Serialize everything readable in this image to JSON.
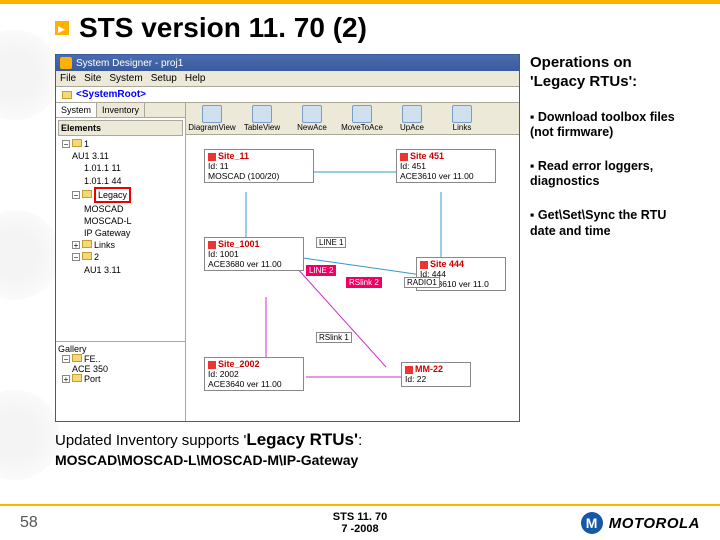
{
  "slide": {
    "title": "STS version 11. 70 (2)",
    "page_number": "58",
    "footer_line1": "STS 11. 70",
    "footer_line2": "7 -2008",
    "brand": "MOTOROLA"
  },
  "right": {
    "heading": "Operations on 'Legacy RTUs':",
    "b1": "Download toolbox files (not firmware)",
    "b2": "Read error loggers, diagnostics",
    "b3": "Get\\Set\\Sync the RTU date and time"
  },
  "captions": {
    "line1_a": "Updated Inventory supports '",
    "line1_b": "Legacy RTUs'",
    "line1_c": ":",
    "line2": "MOSCAD\\MOSCAD-L\\MOSCAD-M\\IP-Gateway"
  },
  "app": {
    "window_title": "System Designer - proj1",
    "menus": [
      "File",
      "Site",
      "System",
      "Setup",
      "Help"
    ],
    "sysroot": "<SystemRoot>",
    "side_tabs": {
      "active": "System",
      "inactive": "Inventory"
    },
    "elements_hdr": "Elements",
    "gallery_hdr": "Gallery",
    "tree": [
      {
        "l": 0,
        "box": "−",
        "fld": true,
        "label": "1"
      },
      {
        "l": 1,
        "box": "",
        "fld": false,
        "label": "AU1 3.11"
      },
      {
        "l": 2,
        "box": "",
        "fld": false,
        "label": "1.01.1 11"
      },
      {
        "l": 2,
        "box": "",
        "fld": false,
        "label": "1.01.1 44"
      },
      {
        "l": 1,
        "box": "−",
        "fld": true,
        "label": "Legacy",
        "legacy": true
      },
      {
        "l": 2,
        "box": "",
        "fld": false,
        "label": "MOSCAD"
      },
      {
        "l": 2,
        "box": "",
        "fld": false,
        "label": "MOSCAD-L"
      },
      {
        "l": 2,
        "box": "",
        "fld": false,
        "label": "IP Gateway"
      },
      {
        "l": 1,
        "box": "+",
        "fld": true,
        "label": "Links"
      },
      {
        "l": 1,
        "box": "−",
        "fld": true,
        "label": "2"
      },
      {
        "l": 2,
        "box": "",
        "fld": false,
        "label": "AU1 3.11"
      }
    ],
    "gallery_items": [
      "FE..",
      "ACE 350",
      "Port"
    ],
    "toolbar": [
      "DiagramView",
      "TableView",
      "NewAce",
      "MoveToAce",
      "UpAce",
      "Links"
    ],
    "nodes": {
      "site11": {
        "title": "Site_11",
        "l1": "Id: 11",
        "l2": "MOSCAD (100/20)"
      },
      "site451": {
        "title": "Site 451",
        "l1": "Id: 451",
        "l2": "ACE3610 ver 11.00"
      },
      "site1001": {
        "title": "Site_1001",
        "l1": "Id: 1001",
        "l2": "ACE3680 ver 11.00"
      },
      "site444": {
        "title": "Site 444",
        "l1": "Id: 444",
        "l2": "ACE3610 ver 11.0"
      },
      "site2002": {
        "title": "Site_2002",
        "l1": "Id: 2002",
        "l2": "ACE3640 ver 11.00"
      },
      "mm22": {
        "title": "MM-22",
        "l1": "Id: 22",
        "l2": ""
      }
    },
    "links": {
      "line1": "LINE 1",
      "line2": "LINE 2",
      "rslink2": "RSlink 2",
      "radio1": "RADIO1",
      "rslink1": "RSlink 1"
    }
  }
}
